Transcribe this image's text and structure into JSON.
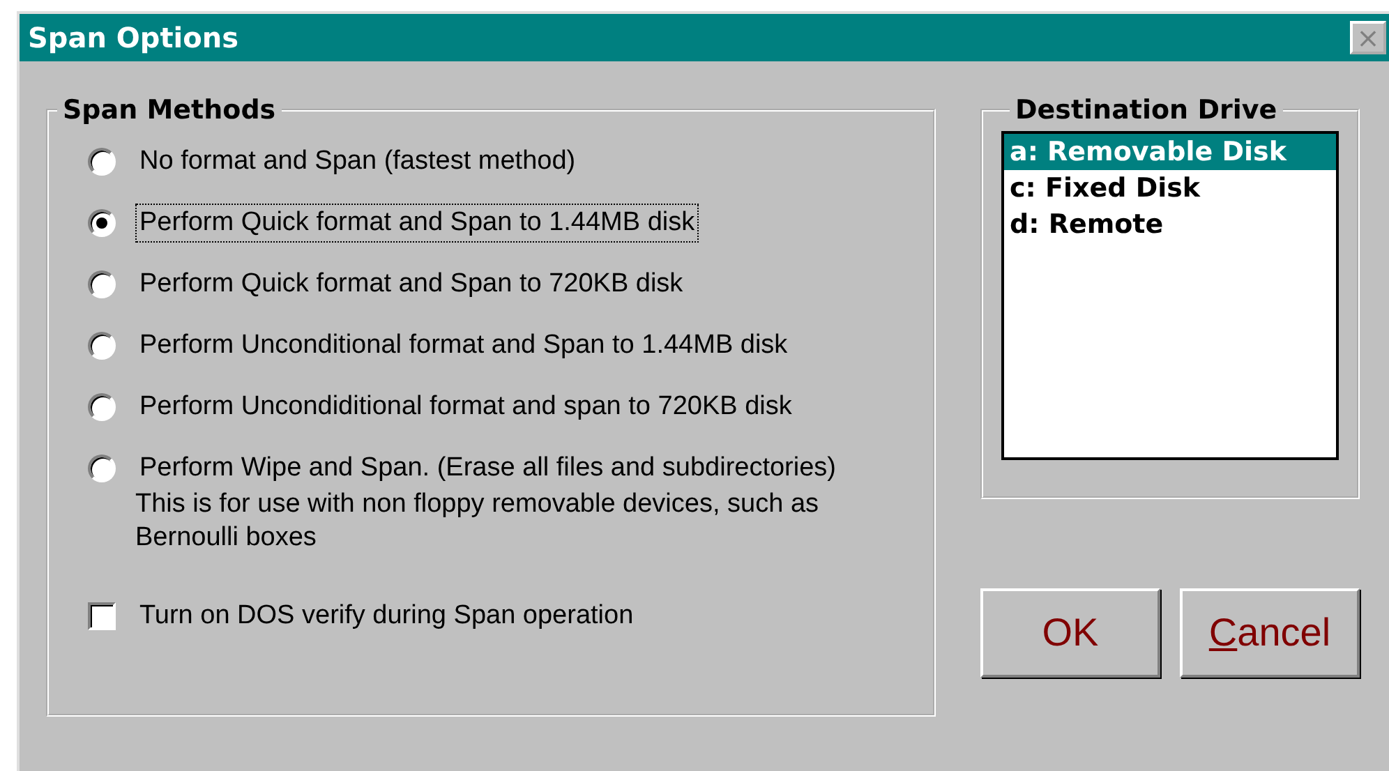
{
  "window": {
    "title": "Span Options",
    "close": "×"
  },
  "span_methods": {
    "title": "Span Methods",
    "options": [
      {
        "label": "No format and Span (fastest method)",
        "selected": false
      },
      {
        "label": "Perform Quick format and Span to 1.44MB disk",
        "selected": true
      },
      {
        "label": "Perform Quick format and Span to 720KB disk",
        "selected": false
      },
      {
        "label": "Perform Unconditional format  and Span to 1.44MB disk",
        "selected": false
      },
      {
        "label": "Perform Uncondiditional format and span to 720KB disk",
        "selected": false
      },
      {
        "label": "Perform Wipe and Span. (Erase all files and subdirectories)",
        "note": "This is for use with non floppy removable devices, such as Bernoulli boxes",
        "selected": false
      }
    ],
    "verify": {
      "label": "Turn on DOS verify during Span operation",
      "checked": false
    }
  },
  "destination_drive": {
    "title": "Destination Drive",
    "items": [
      {
        "label": "a: Removable Disk",
        "selected": true
      },
      {
        "label": "c: Fixed Disk",
        "selected": false
      },
      {
        "label": "d: Remote",
        "selected": false
      }
    ]
  },
  "buttons": [
    {
      "label": "OK",
      "underline_first_letter": false
    },
    {
      "label": "Cancel",
      "underline_first_letter": true
    }
  ]
}
